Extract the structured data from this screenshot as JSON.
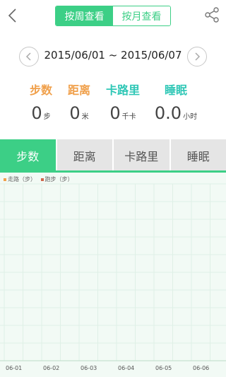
{
  "header": {
    "week_label": "按周查看",
    "month_label": "按月查看"
  },
  "date_range": "2015/06/01 ~ 2015/06/07",
  "stats": [
    {
      "label": "步数",
      "value": "0",
      "unit": "步",
      "color": "#f0a04b"
    },
    {
      "label": "距离",
      "value": "0",
      "unit": "米",
      "color": "#f0a04b"
    },
    {
      "label": "卡路里",
      "value": "0",
      "unit": "千卡",
      "color": "#2fc7b6"
    },
    {
      "label": "睡眠",
      "value": "0.0",
      "unit": "小时",
      "color": "#2fc7b6"
    }
  ],
  "tabs": [
    "步数",
    "距离",
    "卡路里",
    "睡眠"
  ],
  "legend": [
    {
      "label": "走路（步）",
      "color": "#f0a04b"
    },
    {
      "label": "跑步（步）",
      "color": "#d0664a"
    }
  ],
  "chart_data": {
    "type": "bar",
    "categories": [
      "06-01",
      "06-02",
      "06-03",
      "06-04",
      "06-05",
      "06-06"
    ],
    "series": [
      {
        "name": "走路（步）",
        "values": [
          0,
          0,
          0,
          0,
          0,
          0
        ]
      },
      {
        "name": "跑步（步）",
        "values": [
          0,
          0,
          0,
          0,
          0,
          0
        ]
      }
    ],
    "grid": true,
    "legend_position": "top-left"
  },
  "colors": {
    "accent": "#3ccf86",
    "tab_inactive": "#e5e5e5",
    "chart_bg": "#f2faf5",
    "grid": "#dff0e6"
  }
}
